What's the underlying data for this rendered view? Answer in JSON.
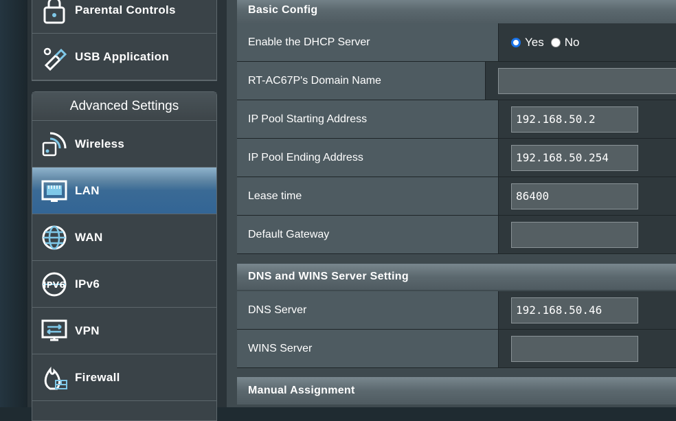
{
  "menu_top": [
    {
      "label": "Parental Controls",
      "icon": "parental-lock-icon"
    },
    {
      "label": "USB Application",
      "icon": "usb-icon"
    }
  ],
  "advanced": {
    "header": "Advanced Settings",
    "items": [
      {
        "label": "Wireless",
        "icon": "wireless-icon",
        "active": false
      },
      {
        "label": "LAN",
        "icon": "lan-icon",
        "active": true
      },
      {
        "label": "WAN",
        "icon": "globe-icon",
        "active": false
      },
      {
        "label": "IPv6",
        "icon": "ipv6-icon",
        "active": false
      },
      {
        "label": "VPN",
        "icon": "vpn-icon",
        "active": false
      },
      {
        "label": "Firewall",
        "icon": "firewall-icon",
        "active": false
      }
    ]
  },
  "basic": {
    "header": "Basic Config",
    "dhcp_label": "Enable the DHCP Server",
    "yes": "Yes",
    "no": "No",
    "domain_label": "RT-AC67P's Domain Name",
    "domain_value": "",
    "pool_start_label": "IP Pool Starting Address",
    "pool_start_value": "192.168.50.2",
    "pool_end_label": "IP Pool Ending Address",
    "pool_end_value": "192.168.50.254",
    "lease_label": "Lease time",
    "lease_value": "86400",
    "gateway_label": "Default Gateway",
    "gateway_value": ""
  },
  "dns": {
    "header": "DNS and WINS Server Setting",
    "dns_label": "DNS Server",
    "dns_value": "192.168.50.46",
    "wins_label": "WINS Server",
    "wins_value": ""
  },
  "manual": {
    "header": "Manual Assignment"
  },
  "colors": {
    "active_menu": "#336595",
    "radio_selected": "#1a73e8"
  }
}
